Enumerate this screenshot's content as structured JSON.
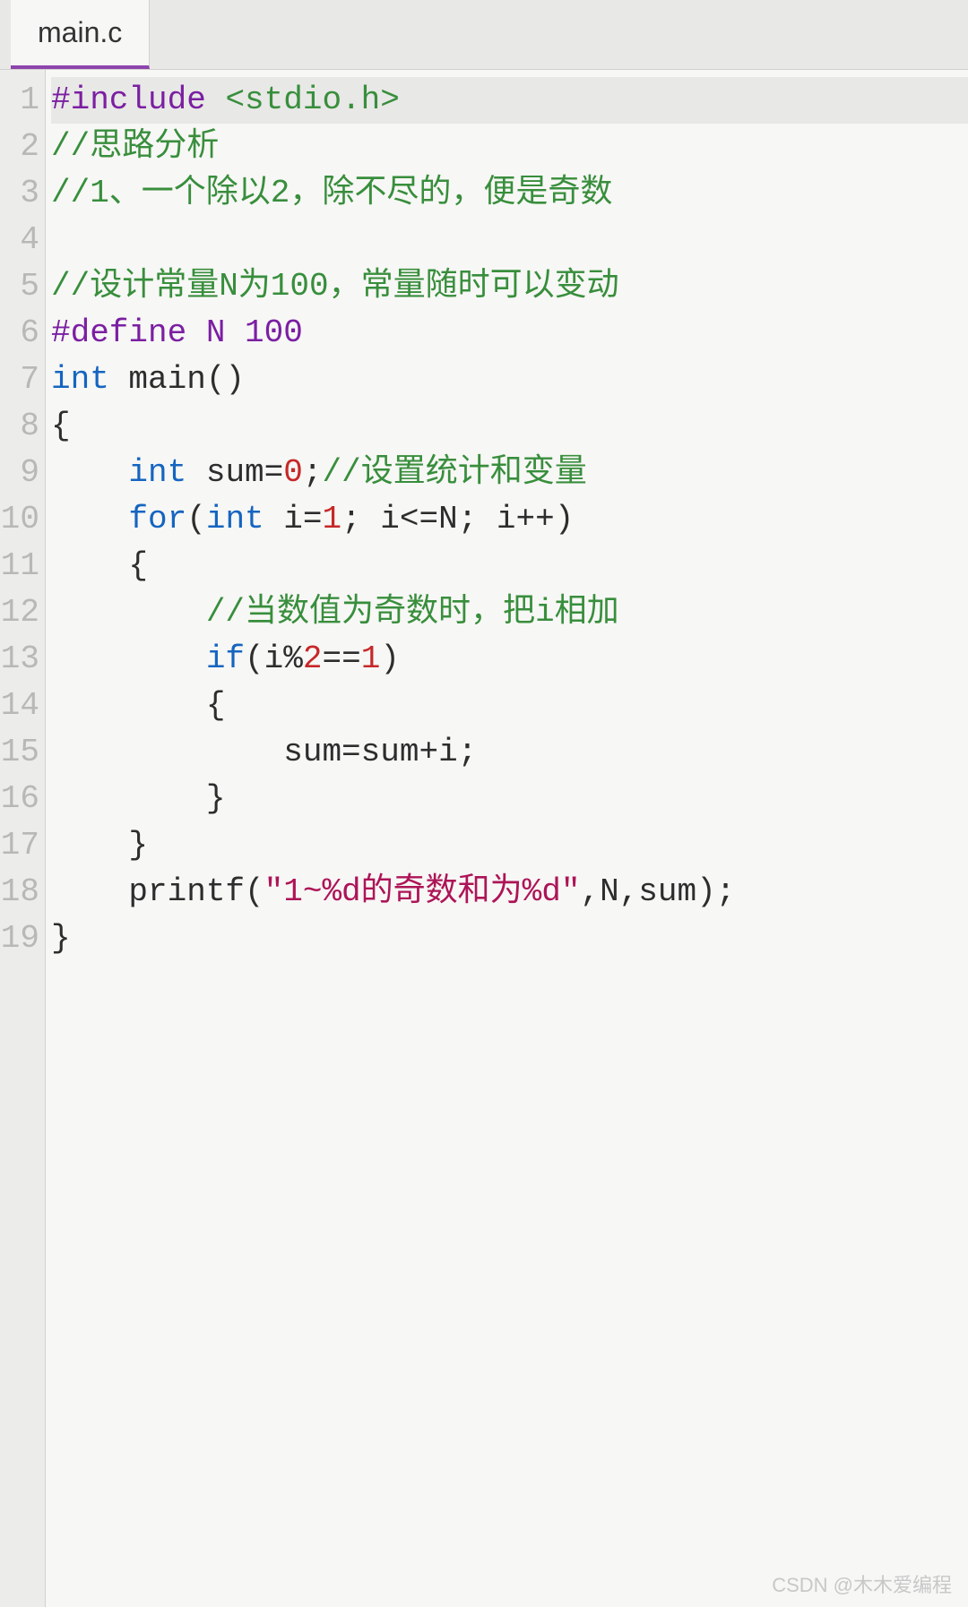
{
  "tab": {
    "filename": "main.c"
  },
  "lines": [
    {
      "n": "1",
      "active": true,
      "tokens": [
        {
          "cls": "tok-preproc",
          "t": "#include "
        },
        {
          "cls": "tok-string",
          "t": "<stdio.h>"
        }
      ]
    },
    {
      "n": "2",
      "active": false,
      "tokens": [
        {
          "cls": "tok-comment",
          "t": "//思路分析"
        }
      ]
    },
    {
      "n": "3",
      "active": false,
      "tokens": [
        {
          "cls": "tok-comment",
          "t": "//1、一个除以2，除不尽的，便是奇数"
        }
      ]
    },
    {
      "n": "4",
      "active": false,
      "tokens": []
    },
    {
      "n": "5",
      "active": false,
      "tokens": [
        {
          "cls": "tok-comment",
          "t": "//设计常量N为100，常量随时可以变动"
        }
      ]
    },
    {
      "n": "6",
      "active": false,
      "tokens": [
        {
          "cls": "tok-preproc",
          "t": "#define N 100"
        }
      ]
    },
    {
      "n": "7",
      "active": false,
      "tokens": [
        {
          "cls": "tok-type",
          "t": "int"
        },
        {
          "cls": "tok-ident",
          "t": " main()"
        }
      ]
    },
    {
      "n": "8",
      "active": false,
      "tokens": [
        {
          "cls": "tok-punct",
          "t": "{"
        }
      ]
    },
    {
      "n": "9",
      "active": false,
      "tokens": [
        {
          "cls": "tok-punct",
          "t": "    "
        },
        {
          "cls": "tok-type",
          "t": "int"
        },
        {
          "cls": "tok-ident",
          "t": " sum="
        },
        {
          "cls": "tok-number",
          "t": "0"
        },
        {
          "cls": "tok-punct",
          "t": ";"
        },
        {
          "cls": "tok-comment",
          "t": "//设置统计和变量"
        }
      ]
    },
    {
      "n": "10",
      "active": false,
      "tokens": [
        {
          "cls": "tok-punct",
          "t": "    "
        },
        {
          "cls": "tok-keyword",
          "t": "for"
        },
        {
          "cls": "tok-punct",
          "t": "("
        },
        {
          "cls": "tok-type",
          "t": "int"
        },
        {
          "cls": "tok-ident",
          "t": " i="
        },
        {
          "cls": "tok-number",
          "t": "1"
        },
        {
          "cls": "tok-punct",
          "t": "; i<=N; i++)"
        }
      ]
    },
    {
      "n": "11",
      "active": false,
      "tokens": [
        {
          "cls": "tok-punct",
          "t": "    {"
        }
      ]
    },
    {
      "n": "12",
      "active": false,
      "tokens": [
        {
          "cls": "tok-punct",
          "t": "        "
        },
        {
          "cls": "tok-comment",
          "t": "//当数值为奇数时，把i相加"
        }
      ]
    },
    {
      "n": "13",
      "active": false,
      "tokens": [
        {
          "cls": "tok-punct",
          "t": "        "
        },
        {
          "cls": "tok-keyword",
          "t": "if"
        },
        {
          "cls": "tok-punct",
          "t": "(i%"
        },
        {
          "cls": "tok-number",
          "t": "2"
        },
        {
          "cls": "tok-punct",
          "t": "=="
        },
        {
          "cls": "tok-number",
          "t": "1"
        },
        {
          "cls": "tok-punct",
          "t": ")"
        }
      ]
    },
    {
      "n": "14",
      "active": false,
      "tokens": [
        {
          "cls": "tok-punct",
          "t": "        {"
        }
      ]
    },
    {
      "n": "15",
      "active": false,
      "tokens": [
        {
          "cls": "tok-punct",
          "t": "            sum=sum+i;"
        }
      ]
    },
    {
      "n": "16",
      "active": false,
      "tokens": [
        {
          "cls": "tok-punct",
          "t": "        }"
        }
      ]
    },
    {
      "n": "17",
      "active": false,
      "tokens": [
        {
          "cls": "tok-punct",
          "t": "    }"
        }
      ]
    },
    {
      "n": "18",
      "active": false,
      "tokens": [
        {
          "cls": "tok-punct",
          "t": "    printf("
        },
        {
          "cls": "tok-strlit",
          "t": "\"1~%d的奇数和为%d\""
        },
        {
          "cls": "tok-punct",
          "t": ",N,sum);"
        }
      ]
    },
    {
      "n": "19",
      "active": false,
      "tokens": [
        {
          "cls": "tok-punct",
          "t": "}"
        }
      ]
    }
  ],
  "watermark": "CSDN @木木爱编程"
}
